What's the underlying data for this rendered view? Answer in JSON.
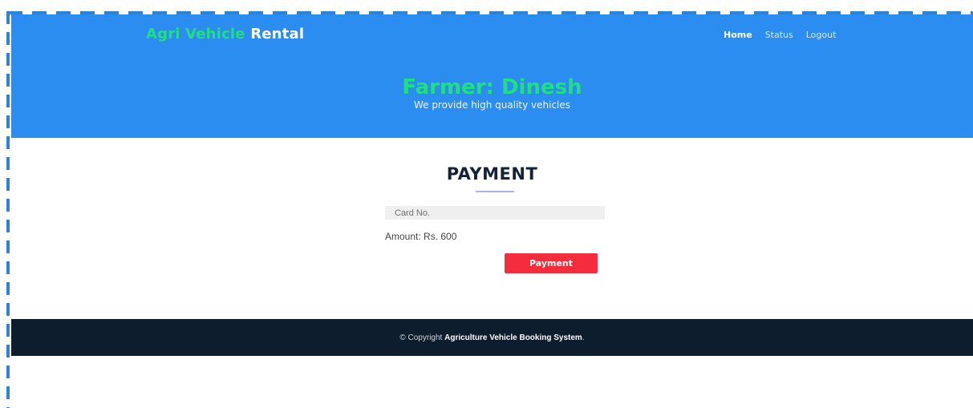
{
  "brand": {
    "part1": "Agri Vehicle",
    "part2": "Rental"
  },
  "nav": {
    "home": "Home",
    "status": "Status",
    "logout": "Logout"
  },
  "hero": {
    "title": "Farmer: Dinesh",
    "subtitle": "We provide high quality vehicles"
  },
  "payment": {
    "title": "PAYMENT",
    "card_placeholder": "Card No.",
    "amount_text": "Amount: Rs. 600",
    "button_label": "Payment"
  },
  "footer": {
    "prefix": "© Copyright",
    "org": "Agriculture Vehicle Booking System",
    "suffix": "."
  },
  "colors": {
    "header_bg": "#2b8df0",
    "brand_green": "#1ee07f",
    "button_red": "#f52c3b",
    "footer_bg": "#0e1d2e",
    "title_dark": "#12233a"
  }
}
